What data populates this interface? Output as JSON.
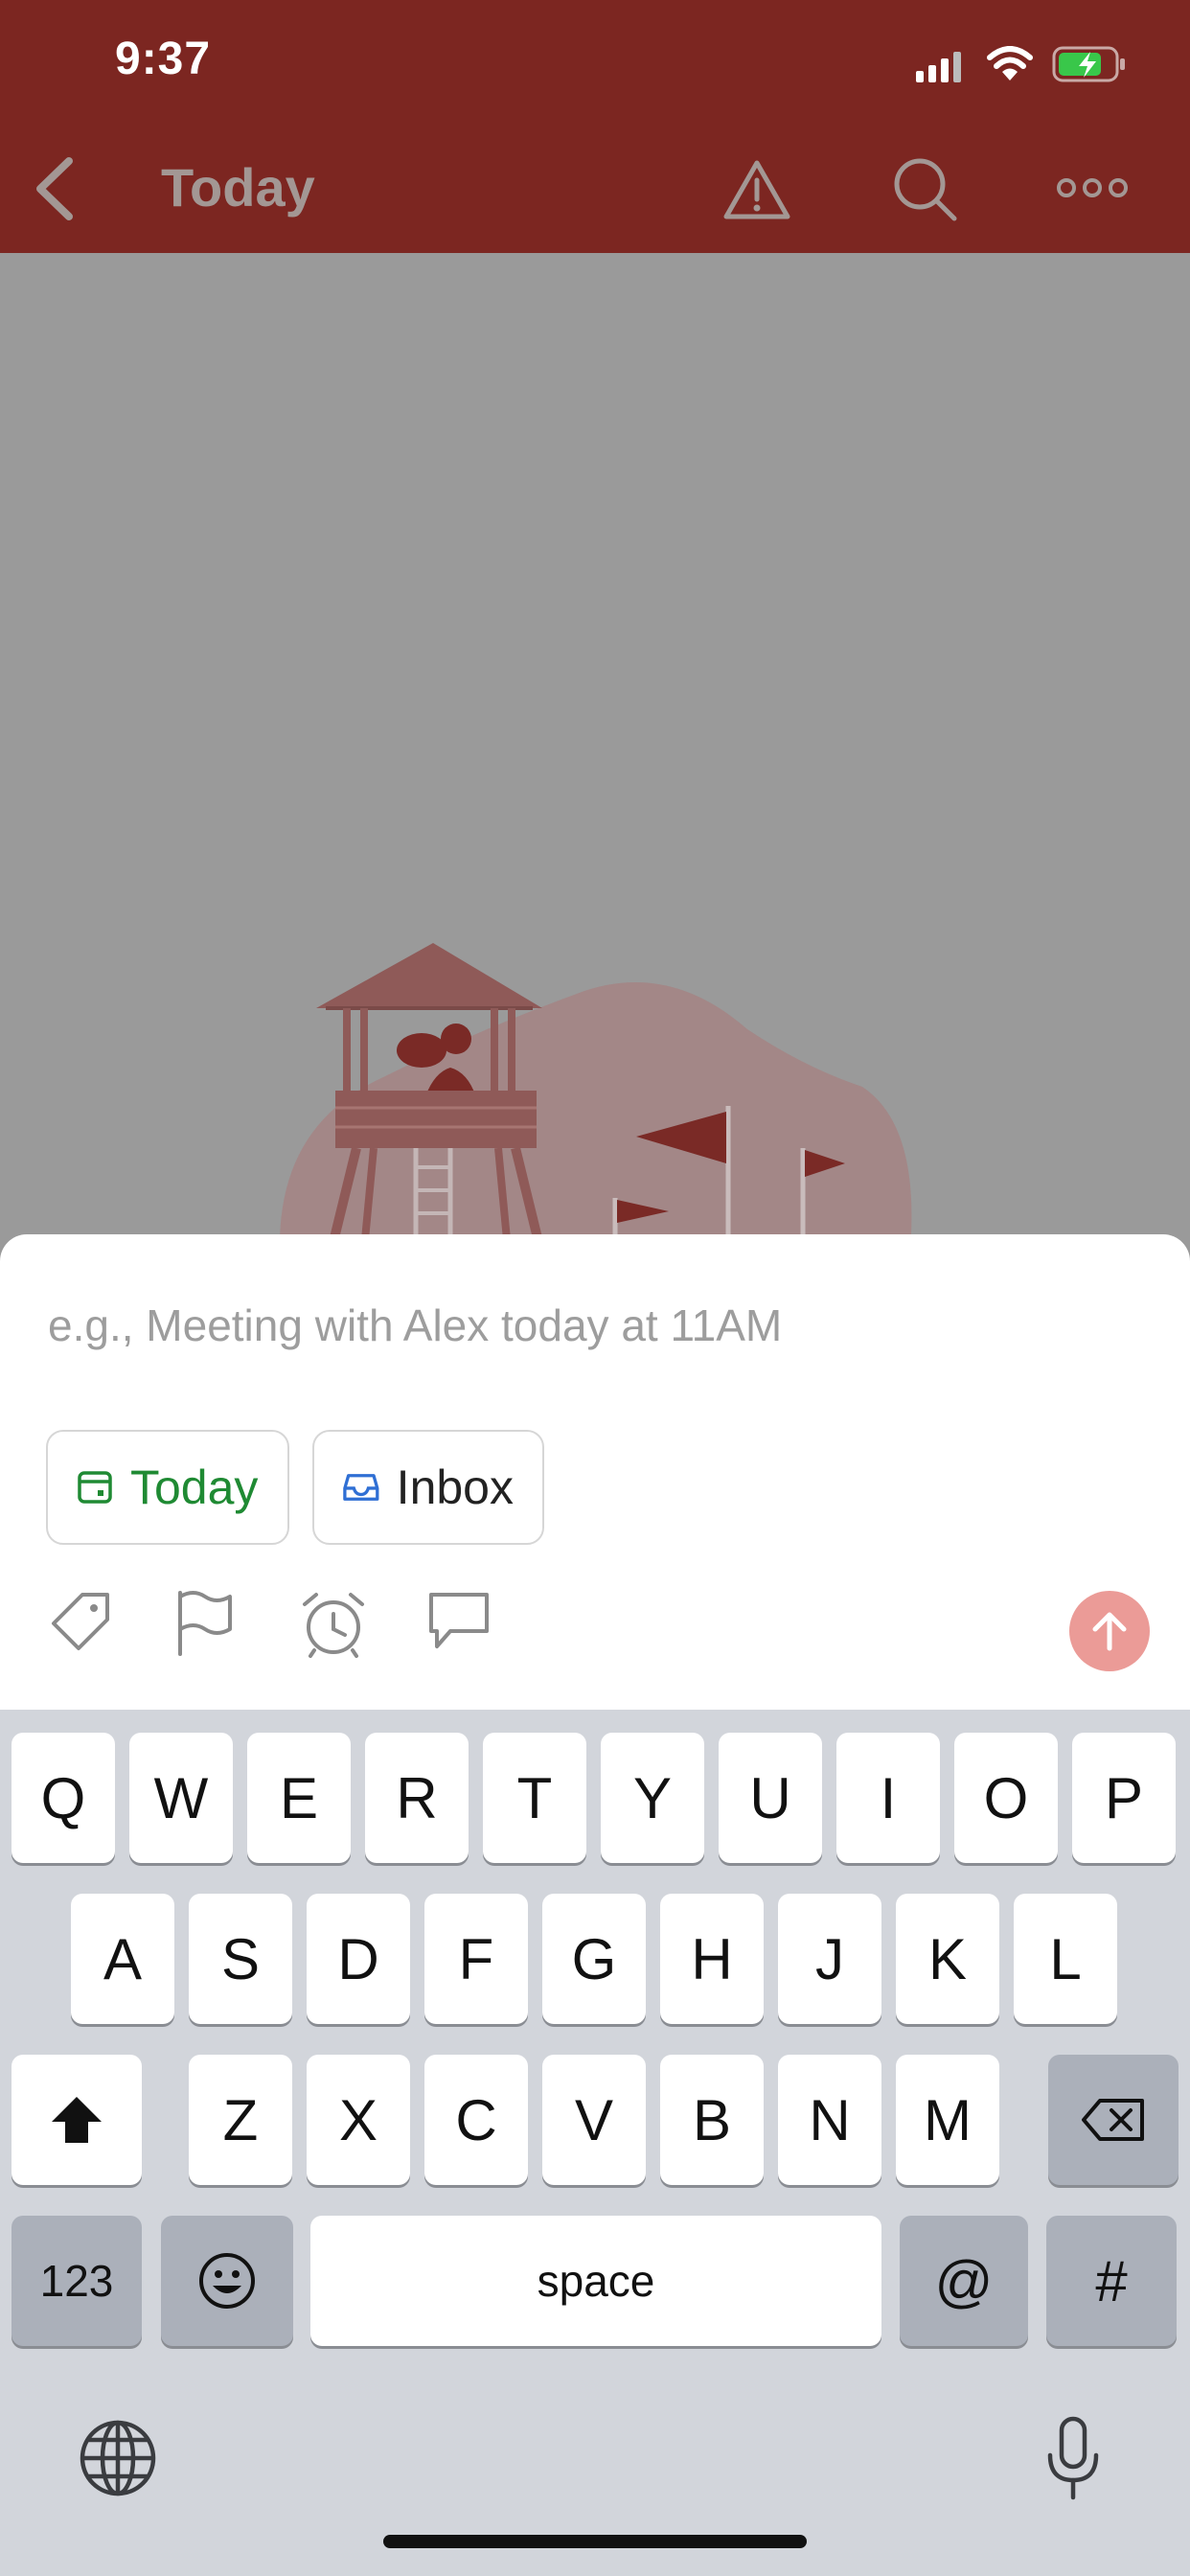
{
  "status_bar": {
    "time": "9:37"
  },
  "nav": {
    "title": "Today",
    "icons": [
      "back-chevron-icon",
      "warning-icon",
      "search-icon",
      "more-icon"
    ]
  },
  "quick_add": {
    "placeholder": "e.g., Meeting with Alex today at 11AM",
    "chips": {
      "today": {
        "label": "Today",
        "icon": "calendar-icon",
        "color": "#1f8a33"
      },
      "inbox": {
        "label": "Inbox",
        "icon": "inbox-icon",
        "color": "#2f6fd4"
      }
    },
    "tools": [
      "label-icon",
      "flag-icon",
      "alarm-icon",
      "comment-icon"
    ],
    "send_icon": "arrow-up-icon",
    "send_color": "#eb9b97"
  },
  "keyboard": {
    "row1": [
      "Q",
      "W",
      "E",
      "R",
      "T",
      "Y",
      "U",
      "I",
      "O",
      "P"
    ],
    "row2": [
      "A",
      "S",
      "D",
      "F",
      "G",
      "H",
      "J",
      "K",
      "L"
    ],
    "row3": [
      "Z",
      "X",
      "C",
      "V",
      "B",
      "N",
      "M"
    ],
    "numbers_label": "123",
    "space_label": "space",
    "at_label": "@",
    "hash_label": "#"
  },
  "colors": {
    "header": "#7c2621",
    "overlay": "#9a9a9a",
    "keyboard_bg": "#d2d5db"
  }
}
